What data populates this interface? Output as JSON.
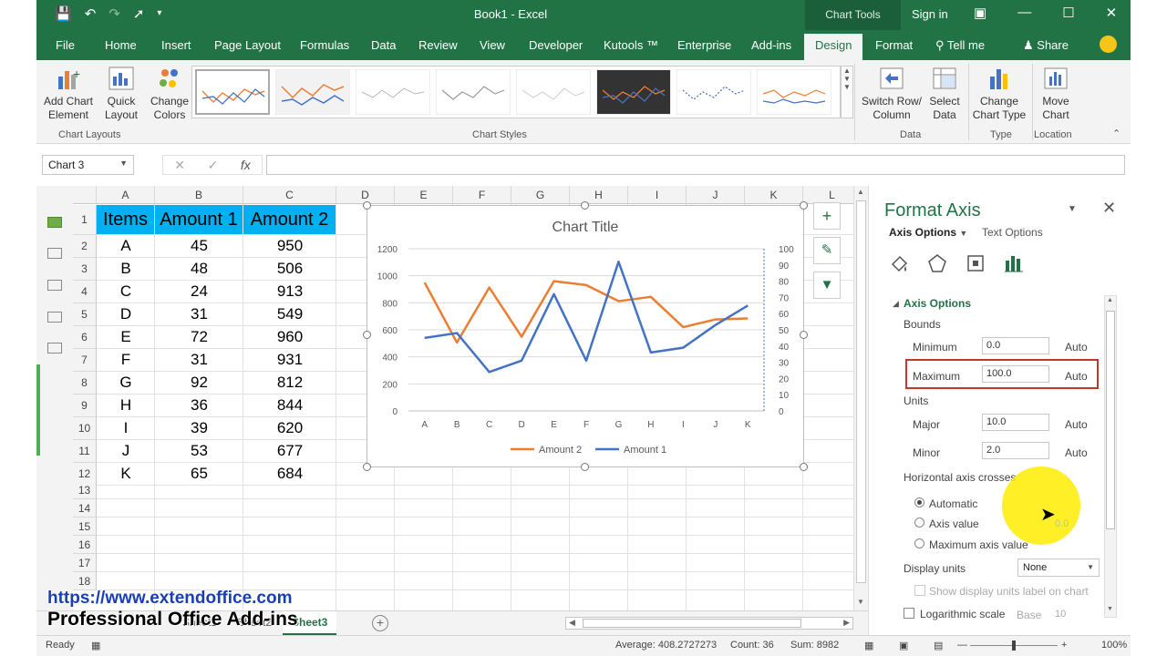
{
  "titlebar": {
    "title": "Book1  -  Excel",
    "chart_tools": "Chart Tools",
    "sign_in": "Sign in"
  },
  "tabs": [
    {
      "label": "File"
    },
    {
      "label": "Home"
    },
    {
      "label": "Insert"
    },
    {
      "label": "Page Layout"
    },
    {
      "label": "Formulas"
    },
    {
      "label": "Data"
    },
    {
      "label": "Review"
    },
    {
      "label": "View"
    },
    {
      "label": "Developer"
    },
    {
      "label": "Kutools ™"
    },
    {
      "label": "Enterprise"
    },
    {
      "label": "Add-ins"
    },
    {
      "label": "Design"
    },
    {
      "label": "Format"
    },
    {
      "label": "Tell me"
    },
    {
      "label": "Share"
    }
  ],
  "ribbon": {
    "add_chart_element": "Add Chart\nElement",
    "quick_layout": "Quick\nLayout",
    "change_colors": "Change\nColors",
    "chart_layouts_label": "Chart Layouts",
    "chart_styles_label": "Chart Styles",
    "switch_row_column": "Switch Row/\nColumn",
    "select_data": "Select\nData",
    "data_label": "Data",
    "change_chart_type": "Change\nChart Type",
    "type_label": "Type",
    "move_chart": "Move\nChart",
    "location_label": "Location"
  },
  "namebox": "Chart 3",
  "columns": [
    "A",
    "B",
    "C",
    "D",
    "E",
    "F",
    "G",
    "H",
    "I",
    "J",
    "K",
    "L"
  ],
  "rows": [
    "1",
    "2",
    "3",
    "4",
    "5",
    "6",
    "7",
    "8",
    "9",
    "10",
    "11",
    "12",
    "13",
    "14",
    "15",
    "16",
    "17",
    "18"
  ],
  "table": {
    "headers": [
      "Items",
      "Amount 1",
      "Amount 2"
    ],
    "rows": [
      [
        "A",
        "45",
        "950"
      ],
      [
        "B",
        "48",
        "506"
      ],
      [
        "C",
        "24",
        "913"
      ],
      [
        "D",
        "31",
        "549"
      ],
      [
        "E",
        "72",
        "960"
      ],
      [
        "F",
        "31",
        "931"
      ],
      [
        "G",
        "92",
        "812"
      ],
      [
        "H",
        "36",
        "844"
      ],
      [
        "I",
        "39",
        "620"
      ],
      [
        "J",
        "53",
        "677"
      ],
      [
        "K",
        "65",
        "684"
      ]
    ]
  },
  "chart_data": {
    "type": "line",
    "title": "Chart Title",
    "categories": [
      "A",
      "B",
      "C",
      "D",
      "E",
      "F",
      "G",
      "H",
      "I",
      "J",
      "K"
    ],
    "series": [
      {
        "name": "Amount 2",
        "axis": "left",
        "color": "#ed7d31",
        "values": [
          950,
          506,
          913,
          549,
          960,
          931,
          812,
          844,
          620,
          677,
          684
        ]
      },
      {
        "name": "Amount 1",
        "axis": "right",
        "color": "#4472c4",
        "values": [
          45,
          48,
          24,
          31,
          72,
          31,
          92,
          36,
          39,
          53,
          65
        ]
      }
    ],
    "y_left": {
      "min": 0,
      "max": 1200,
      "step": 200,
      "ticks": [
        "0",
        "200",
        "400",
        "600",
        "800",
        "1000",
        "1200"
      ]
    },
    "y_right": {
      "min": 0,
      "max": 100,
      "step": 10,
      "ticks": [
        "0",
        "10",
        "20",
        "30",
        "40",
        "50",
        "60",
        "70",
        "80",
        "90",
        "100"
      ]
    },
    "grid": true,
    "legend": "bottom"
  },
  "sheets": [
    "Sheet1",
    "Sheet2",
    "Sheet3"
  ],
  "watermark": {
    "url": "https://www.extendoffice.com",
    "tagline": "Professional Office Add-ins"
  },
  "status": {
    "ready": "Ready",
    "average": "Average: 408.2727273",
    "count": "Count: 36",
    "sum": "Sum: 8982",
    "zoom": "100%"
  },
  "pane": {
    "title": "Format Axis",
    "tab_axis_options": "Axis Options",
    "tab_text_options": "Text Options",
    "section": "Axis Options",
    "bounds": "Bounds",
    "minimum_label": "Minimum",
    "minimum_value": "0.0",
    "maximum_label": "Maximum",
    "maximum_value": "100.0",
    "units": "Units",
    "major_label": "Major",
    "major_value": "10.0",
    "minor_label": "Minor",
    "minor_value": "2.0",
    "auto": "Auto",
    "horizontal_axis_crosses": "Horizontal axis crosses",
    "automatic": "Automatic",
    "axis_value": "Axis value",
    "axis_value_input": "0.0",
    "maximum_axis_value": "Maximum axis value",
    "display_units": "Display units",
    "display_units_value": "None",
    "show_display_units": "Show display units label on chart",
    "logarithmic_scale": "Logarithmic scale",
    "base_label": "Base",
    "base_value": "10"
  },
  "colors": {
    "excel_green": "#217346",
    "header_fill": "#00b0f0",
    "series_orange": "#ed7d31",
    "series_blue": "#4472c4",
    "highlight_red": "#c0392b"
  }
}
